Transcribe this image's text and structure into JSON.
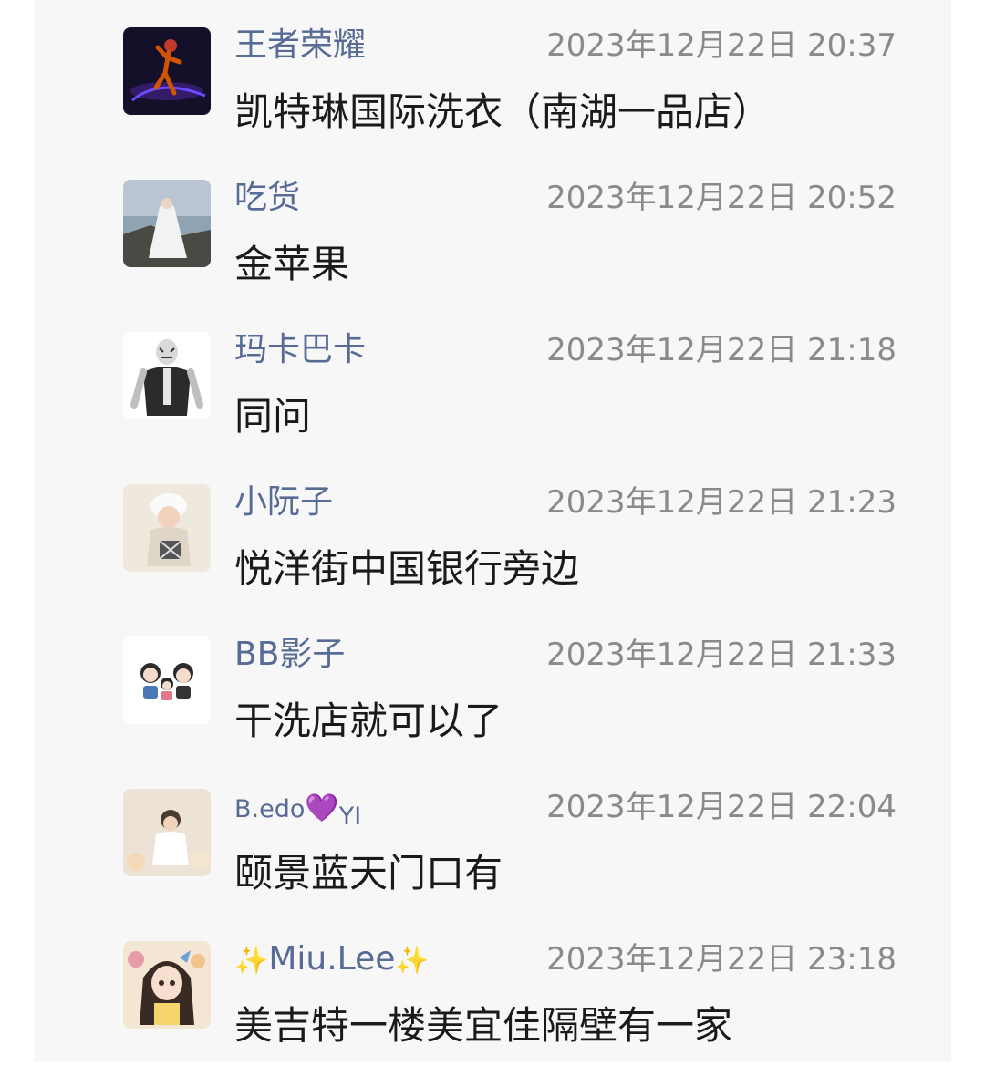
{
  "comments": [
    {
      "name": "王者荣耀",
      "time": "2023年12月22日 20:37",
      "text": "凯特琳国际洗衣（南湖一品店）",
      "avatar_icon": "dancer-avatar-icon"
    },
    {
      "name": "吃货",
      "time": "2023年12月22日 20:52",
      "text": "金苹果",
      "avatar_icon": "bride-avatar-icon"
    },
    {
      "name": "玛卡巴卡",
      "time": "2023年12月22日 21:18",
      "text": "同问",
      "avatar_icon": "tiger-avatar-icon"
    },
    {
      "name": "小阮子",
      "time": "2023年12月22日 21:23",
      "text": "悦洋街中国银行旁边",
      "avatar_icon": "baby-avatar-icon"
    },
    {
      "name": "BB影子",
      "time": "2023年12月22日 21:33",
      "text": "干洗店就可以了",
      "avatar_icon": "cartoon-family-avatar-icon"
    },
    {
      "name_prefix": "B.edo",
      "name_emoji": "💜",
      "name_suffix": "YI",
      "time": "2023年12月22日 22:04",
      "text": "颐景蓝天门口有",
      "avatar_icon": "child-avatar-icon"
    },
    {
      "name_prefix": "✨",
      "name_main": "Miu.Lee",
      "name_emoji": "✨",
      "time": "2023年12月22日 23:18",
      "text": "美吉特一楼美宜佳隔壁有一家",
      "avatar_icon": "anime-girl-avatar-icon"
    }
  ],
  "colors": {
    "name": "#576b95",
    "time": "#8a8a8a",
    "text": "#1a1a1a",
    "panel": "#f7f7f7"
  }
}
